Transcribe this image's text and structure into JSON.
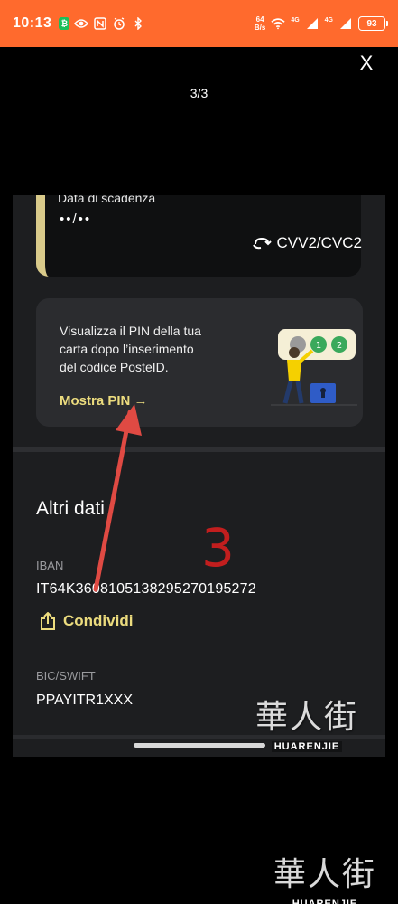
{
  "status_bar": {
    "time": "10:13",
    "net_speed_value": "64",
    "net_speed_unit": "B/s",
    "signal_1_label": "4G",
    "signal_2_label": "4G",
    "battery_level": "93"
  },
  "viewer": {
    "close_label": "X",
    "page_counter": "3/3"
  },
  "screenshot": {
    "card": {
      "expiry_label": "Data di scadenza",
      "expiry_value": "••/••",
      "cvv_label": "CVV2/CVC2"
    },
    "pin_card": {
      "description": "Visualizza il PIN della tua\ncarta dopo l’inserimento\ndel codice PosteID.",
      "link_label": "Mostra PIN →"
    },
    "other_data": {
      "title": "Altri dati",
      "iban_label": "IBAN",
      "iban_value": "IT64K3608105138295270195272",
      "share_label": "Condividi",
      "bic_label": "BIC/SWIFT",
      "bic_value": "PPAYITR1XXX"
    },
    "annotation_number": "3"
  },
  "watermark": {
    "chinese_text": "華人街",
    "latin_text": "HUARENJIE"
  },
  "colors": {
    "status_bar": "#ff6a2d",
    "accent_yellow": "#ecdc7e",
    "card_stripe": "#d9ca8a",
    "annotation_red": "#c21e1e"
  }
}
